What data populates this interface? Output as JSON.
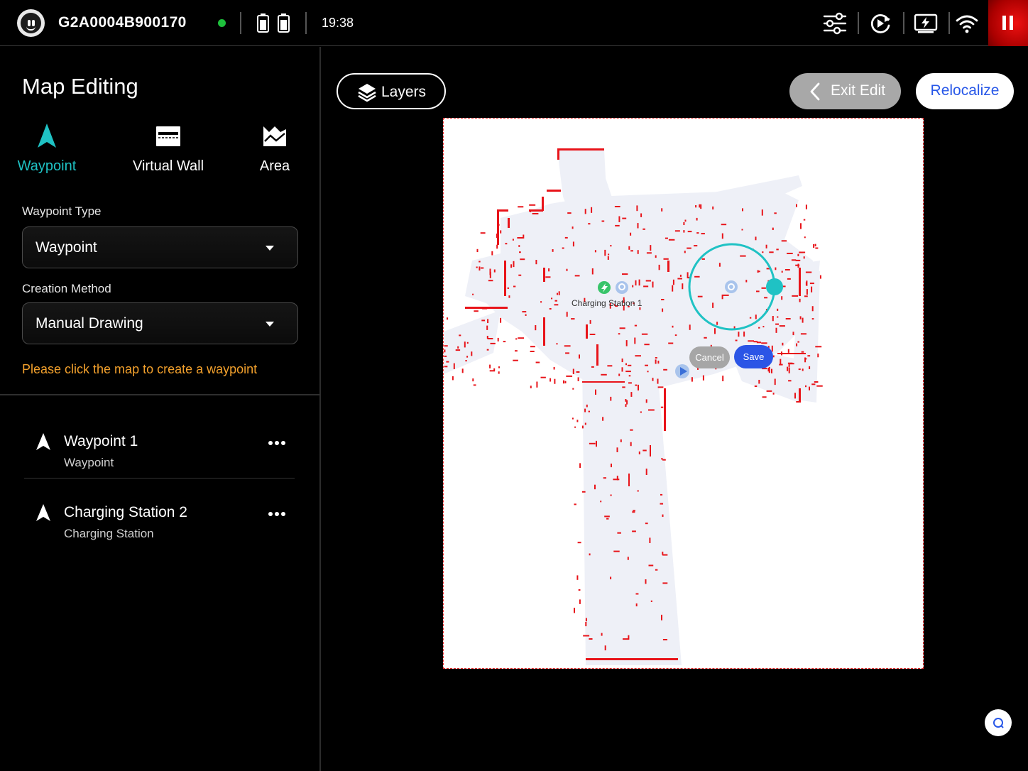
{
  "topbar": {
    "device_id": "G2A0004B900170",
    "time": "19:38",
    "connection_color": "#1ec03c",
    "icons": [
      "robot-face-icon",
      "battery-icon",
      "battery-icon",
      "settings-sliders-icon",
      "sync-icon",
      "charging-screen-icon",
      "wifi-icon",
      "pause-icon"
    ]
  },
  "panel": {
    "title": "Map Editing",
    "tabs": [
      {
        "label": "Waypoint",
        "icon": "navigation-arrow-icon",
        "active": true
      },
      {
        "label": "Virtual Wall",
        "icon": "virtual-wall-icon",
        "active": false
      },
      {
        "label": "Area",
        "icon": "area-icon",
        "active": false
      }
    ],
    "waypoint_type_label": "Waypoint Type",
    "waypoint_type_value": "Waypoint",
    "creation_method_label": "Creation Method",
    "creation_method_value": "Manual Drawing",
    "hint": "Please click the map to create a waypoint",
    "hint_color": "#f2a02c",
    "accent_color": "#1fc2c4",
    "items": [
      {
        "title": "Waypoint 1",
        "subtitle": "Waypoint"
      },
      {
        "title": "Charging Station 2",
        "subtitle": "Charging Station"
      }
    ]
  },
  "map": {
    "layers_label": "Layers",
    "exit_label": "Exit Edit",
    "relocalize_label": "Relocalize",
    "charging_station_label": "Charging Station 1",
    "cancel_label": "Cancel",
    "save_label": "Save",
    "obstacle_color": "#e8141a",
    "free_space_color": "#eef0f7"
  }
}
